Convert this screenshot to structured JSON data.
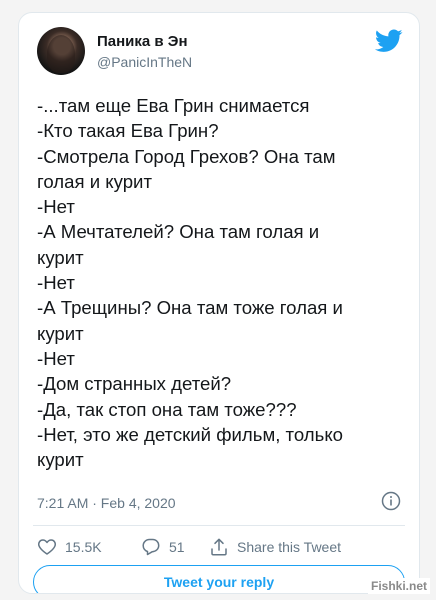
{
  "tweet": {
    "author_name": "Паника в Эн",
    "author_handle": "@PanicInTheN",
    "lines": [
      "-...там еще Ева Грин снимается",
      "-Кто такая Ева Грин?",
      "-Смотрела Город Грехов? Она там",
      "голая и курит",
      "-Нет",
      "-А Мечтателей? Она там голая и",
      "курит",
      "-Нет",
      "-А Трещины? Она там тоже голая и",
      "курит",
      "-Нет",
      "-Дом странных детей?",
      "-Да, так стоп она там тоже???",
      "-Нет, это же детский фильм, только",
      "курит"
    ],
    "timestamp": "7:21 AM · Feb 4, 2020",
    "likes": "15.5K",
    "replies": "51",
    "share_label": "Share this Tweet",
    "reply_button_label": "Tweet your reply"
  },
  "watermark": "Fishki.net",
  "icons": {
    "brand": "twitter-bird-icon",
    "info": "info-icon",
    "like": "heart-icon",
    "reply": "reply-icon",
    "share": "share-icon"
  },
  "colors": {
    "accent": "#1da1f2",
    "text": "#14171a",
    "secondary": "#657786",
    "border": "#e1e8ed"
  }
}
